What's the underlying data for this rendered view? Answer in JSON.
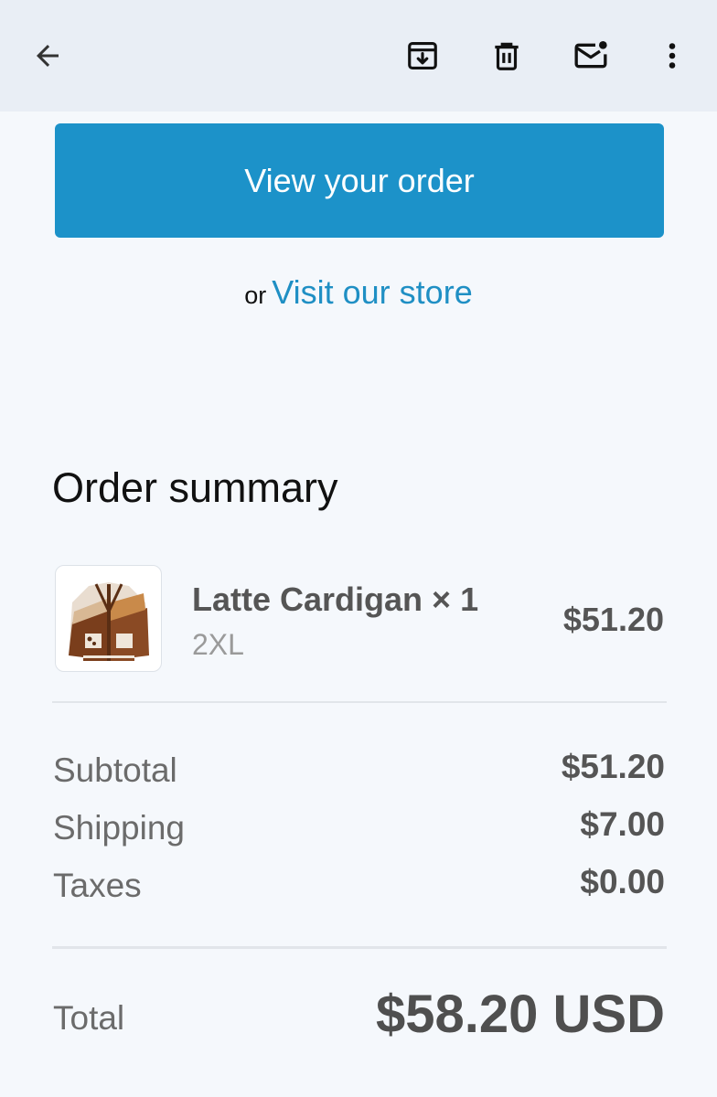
{
  "toolbar": {
    "back_icon": "arrow-left-icon",
    "archive_icon": "archive-icon",
    "delete_icon": "trash-icon",
    "mark_unread_icon": "mail-unread-icon",
    "more_icon": "more-vert-icon"
  },
  "email": {
    "view_order_label": "View your order",
    "or_text": "or",
    "visit_store_label": "Visit our store",
    "summary_title": "Order summary",
    "item": {
      "name": "Latte Cardigan × 1",
      "variant": "2XL",
      "price": "$51.20",
      "thumbnail": "cardigan-image"
    },
    "totals": [
      {
        "label": "Subtotal",
        "value": "$51.20"
      },
      {
        "label": "Shipping",
        "value": "$7.00"
      },
      {
        "label": "Taxes",
        "value": "$0.00"
      }
    ],
    "total": {
      "label": "Total",
      "value": "$58.20 USD"
    }
  },
  "colors": {
    "accent": "#1c92c9",
    "link": "#1f8fc4",
    "background": "#f5f8fc",
    "toolbar": "#e9eef5"
  }
}
